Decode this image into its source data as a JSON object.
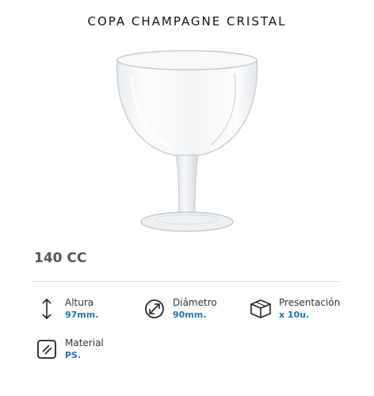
{
  "product": {
    "title": "COPA CHAMPAGNE CRISTAL",
    "capacity": "140 CC"
  },
  "specs": {
    "altura": {
      "label": "Altura",
      "value": "97mm.",
      "icon": "height-arrows-icon"
    },
    "diametro": {
      "label": "Diámetro",
      "value": "90mm.",
      "icon": "diameter-icon"
    },
    "presentacion": {
      "label": "Presentación",
      "value": "x 10u.",
      "icon": "box-icon"
    },
    "material": {
      "label": "Material",
      "value": "PS.",
      "icon": "material-icon"
    }
  },
  "colors": {
    "accent": "#2c6fb3",
    "capacity_text": "#555555",
    "divider": "#d8d8d8"
  }
}
